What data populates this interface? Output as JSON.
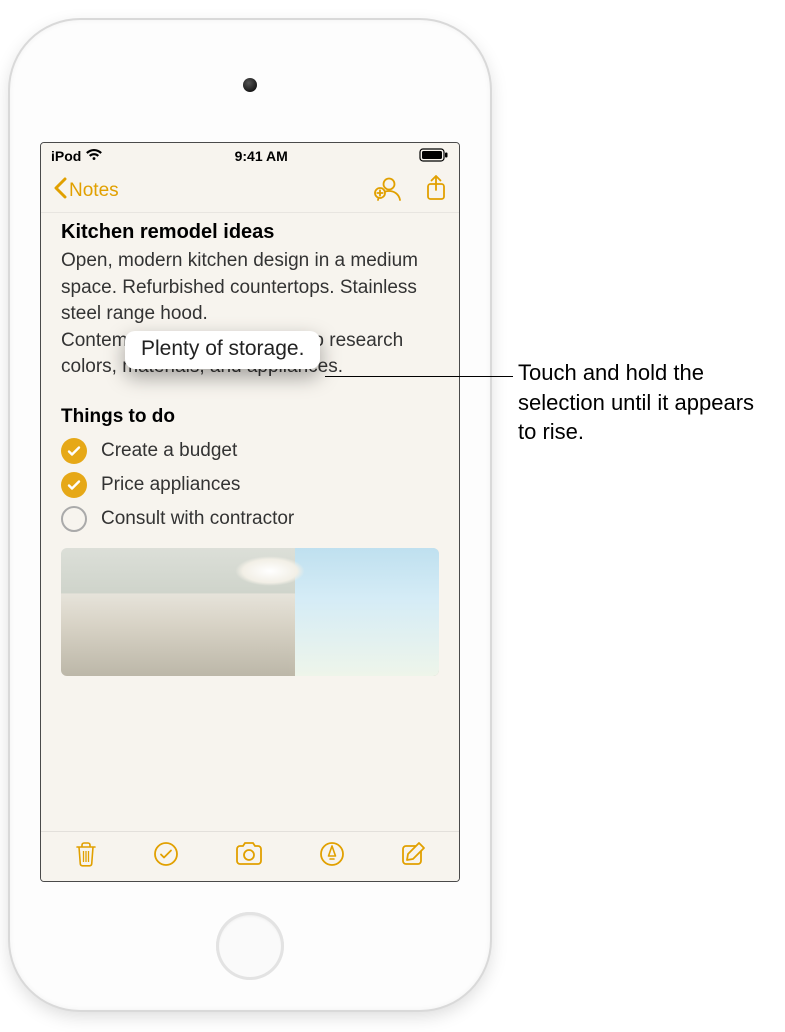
{
  "status": {
    "carrier": "iPod",
    "time": "9:41 AM"
  },
  "nav": {
    "back_label": "Notes"
  },
  "note": {
    "title": "Kitchen remodel ideas",
    "body_before": "Open, modern kitchen design in a medium space. Refurbished countertops. Stainless steel range hood.",
    "lifted_text": "Plenty of storage.",
    "body_after": "Contemporary lighting. Need to research colors, materials, and appliances.",
    "subheading": "Things to do",
    "checklist": [
      {
        "label": "Create a budget",
        "checked": true
      },
      {
        "label": "Price appliances",
        "checked": true
      },
      {
        "label": "Consult with contractor",
        "checked": false
      }
    ]
  },
  "callout": {
    "text": "Touch and hold the selection until it appears to rise."
  }
}
